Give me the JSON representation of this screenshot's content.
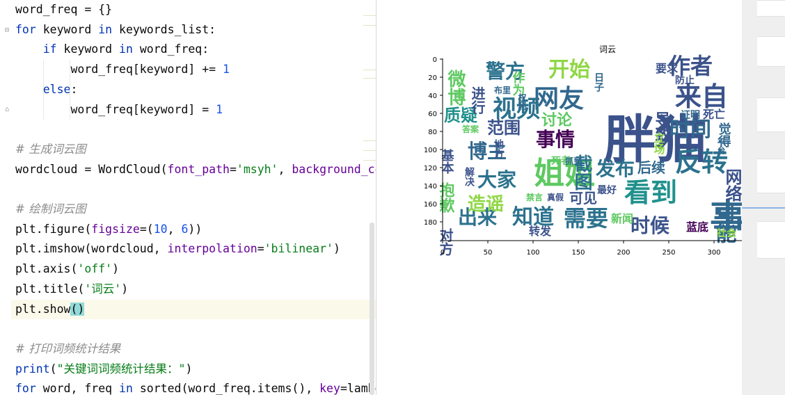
{
  "editor": {
    "lines": [
      {
        "tokens": [
          {
            "t": "word_freq = {}",
            "c": ""
          }
        ]
      },
      {
        "tokens": [
          {
            "t": "for",
            "c": "kw"
          },
          {
            "t": " keyword ",
            "c": ""
          },
          {
            "t": "in",
            "c": "kw"
          },
          {
            "t": " keywords_list:",
            "c": ""
          }
        ]
      },
      {
        "tokens": [
          {
            "t": "    ",
            "c": ""
          },
          {
            "t": "if",
            "c": "kw"
          },
          {
            "t": " keyword ",
            "c": ""
          },
          {
            "t": "in",
            "c": "kw"
          },
          {
            "t": " word_freq:",
            "c": ""
          }
        ]
      },
      {
        "tokens": [
          {
            "t": "        word_freq[keyword] += ",
            "c": ""
          },
          {
            "t": "1",
            "c": "num"
          }
        ]
      },
      {
        "tokens": [
          {
            "t": "    ",
            "c": ""
          },
          {
            "t": "else",
            "c": "kw"
          },
          {
            "t": ":",
            "c": ""
          }
        ]
      },
      {
        "tokens": [
          {
            "t": "        word_freq[keyword] = ",
            "c": ""
          },
          {
            "t": "1",
            "c": "num"
          }
        ]
      },
      {
        "tokens": []
      },
      {
        "tokens": [
          {
            "t": "# 生成词云图",
            "c": "cmt"
          }
        ]
      },
      {
        "tokens": [
          {
            "t": "wordcloud = WordCloud(",
            "c": ""
          },
          {
            "t": "font_path",
            "c": "param"
          },
          {
            "t": "=",
            "c": ""
          },
          {
            "t": "'msyh'",
            "c": "str"
          },
          {
            "t": ", ",
            "c": ""
          },
          {
            "t": "background_co",
            "c": "param"
          }
        ]
      },
      {
        "tokens": []
      },
      {
        "tokens": [
          {
            "t": "# 绘制词云图",
            "c": "cmt"
          }
        ]
      },
      {
        "tokens": [
          {
            "t": "plt.figure(",
            "c": ""
          },
          {
            "t": "figsize",
            "c": "param"
          },
          {
            "t": "=(",
            "c": ""
          },
          {
            "t": "10",
            "c": "num"
          },
          {
            "t": ", ",
            "c": ""
          },
          {
            "t": "6",
            "c": "num"
          },
          {
            "t": "))",
            "c": ""
          }
        ]
      },
      {
        "tokens": [
          {
            "t": "plt.imshow(wordcloud, ",
            "c": ""
          },
          {
            "t": "interpolation",
            "c": "param"
          },
          {
            "t": "=",
            "c": ""
          },
          {
            "t": "'bilinear'",
            "c": "str"
          },
          {
            "t": ")",
            "c": ""
          }
        ]
      },
      {
        "tokens": [
          {
            "t": "plt.axis(",
            "c": ""
          },
          {
            "t": "'off'",
            "c": "str"
          },
          {
            "t": ")",
            "c": ""
          }
        ]
      },
      {
        "tokens": [
          {
            "t": "plt.title(",
            "c": ""
          },
          {
            "t": "'词云'",
            "c": "str"
          },
          {
            "t": ")",
            "c": ""
          }
        ]
      },
      {
        "tokens": [
          {
            "t": "plt.show",
            "c": ""
          },
          {
            "t": "()",
            "c": "brace"
          }
        ],
        "highlight": true
      },
      {
        "tokens": []
      },
      {
        "tokens": [
          {
            "t": "# 打印词频统计结果",
            "c": "cmt"
          }
        ]
      },
      {
        "tokens": [
          {
            "t": "print",
            "c": "kw"
          },
          {
            "t": "(",
            "c": ""
          },
          {
            "t": "\"关键词词频统计结果：\"",
            "c": "str"
          },
          {
            "t": ")",
            "c": ""
          }
        ]
      },
      {
        "tokens": [
          {
            "t": "for",
            "c": "kw"
          },
          {
            "t": " word, freq ",
            "c": ""
          },
          {
            "t": "in",
            "c": "kw"
          },
          {
            "t": " sorted(word_freq.items(), ",
            "c": ""
          },
          {
            "t": "key",
            "c": "param"
          },
          {
            "t": "=lambd",
            "c": ""
          }
        ]
      }
    ]
  },
  "plot": {
    "title": "词云",
    "x_ticks": [
      "0",
      "50",
      "100",
      "150",
      "200",
      "250",
      "300"
    ],
    "y_ticks": [
      "0",
      "20",
      "40",
      "60",
      "80",
      "100",
      "120",
      "140",
      "160",
      "180"
    ],
    "words": [
      {
        "text": "胖猫",
        "color": "#3b528b"
      },
      {
        "text": "事",
        "color": "#31688e"
      },
      {
        "text": "姐姐",
        "color": "#5ec962"
      },
      {
        "text": "反转",
        "color": "#2c728e"
      },
      {
        "text": "来自",
        "color": "#3b528b"
      },
      {
        "text": "看到",
        "color": "#21918c"
      },
      {
        "text": "网友",
        "color": "#31688e"
      },
      {
        "text": "视频",
        "color": "#2c728e"
      },
      {
        "text": "作者",
        "color": "#3b528b"
      },
      {
        "text": "时间",
        "color": "#31688e"
      },
      {
        "text": "开始",
        "color": "#8fd744"
      },
      {
        "text": "警方",
        "color": "#2c728e"
      },
      {
        "text": "博主",
        "color": "#31688e"
      },
      {
        "text": "大家",
        "color": "#2c728e"
      },
      {
        "text": "事情",
        "color": "#440154"
      },
      {
        "text": "发布",
        "color": "#2c728e"
      },
      {
        "text": "需要",
        "color": "#2c728e"
      },
      {
        "text": "知道",
        "color": "#2c728e"
      },
      {
        "text": "时候",
        "color": "#3b528b"
      },
      {
        "text": "可能",
        "color": "#31688e"
      },
      {
        "text": "出来",
        "color": "#2c728e"
      },
      {
        "text": "造谣",
        "color": "#8fd744"
      },
      {
        "text": "质疑",
        "color": "#21918c"
      },
      {
        "text": "范围",
        "color": "#3b528b"
      },
      {
        "text": "讨论",
        "color": "#5ec962"
      },
      {
        "text": "截图",
        "color": "#2c728e"
      },
      {
        "text": "微博",
        "color": "#5ec962"
      },
      {
        "text": "网络",
        "color": "#3b528b"
      },
      {
        "text": "后续",
        "color": "#31688e"
      },
      {
        "text": "可见",
        "color": "#3b528b"
      },
      {
        "text": "转发",
        "color": "#3b528b"
      },
      {
        "text": "抱歉",
        "color": "#5ec962"
      },
      {
        "text": "对方",
        "color": "#3b528b"
      },
      {
        "text": "基本",
        "color": "#3b528b"
      },
      {
        "text": "新闻",
        "color": "#5ec962"
      },
      {
        "text": "蓝底",
        "color": "#440154"
      },
      {
        "text": "社会",
        "color": "#8fd744"
      },
      {
        "text": "要求",
        "color": "#3b528b"
      },
      {
        "text": "导致",
        "color": "#3b528b"
      },
      {
        "text": "死者",
        "color": "#5ec962"
      },
      {
        "text": "死亡",
        "color": "#3b528b"
      },
      {
        "text": "觉得",
        "color": "#31688e"
      },
      {
        "text": "作为",
        "color": "#5ec962"
      },
      {
        "text": "进行",
        "color": "#3b528b"
      },
      {
        "text": "最好",
        "color": "#3b528b"
      },
      {
        "text": "立场",
        "color": "#8fd744"
      },
      {
        "text": "证明",
        "color": "#31688e"
      },
      {
        "text": "解决",
        "color": "#3b528b"
      },
      {
        "text": "真假",
        "color": "#3b528b"
      },
      {
        "text": "禁言",
        "color": "#5ec962"
      },
      {
        "text": "平台",
        "color": "#31688e"
      },
      {
        "text": "地方",
        "color": "#3b528b"
      },
      {
        "text": "防止",
        "color": "#3b528b"
      },
      {
        "text": "日子",
        "color": "#31688e"
      },
      {
        "text": "权利",
        "color": "#31688e"
      },
      {
        "text": "布里",
        "color": "#31688e"
      },
      {
        "text": "抓到",
        "color": "#31688e"
      },
      {
        "text": "答案",
        "color": "#5ec962"
      }
    ]
  }
}
